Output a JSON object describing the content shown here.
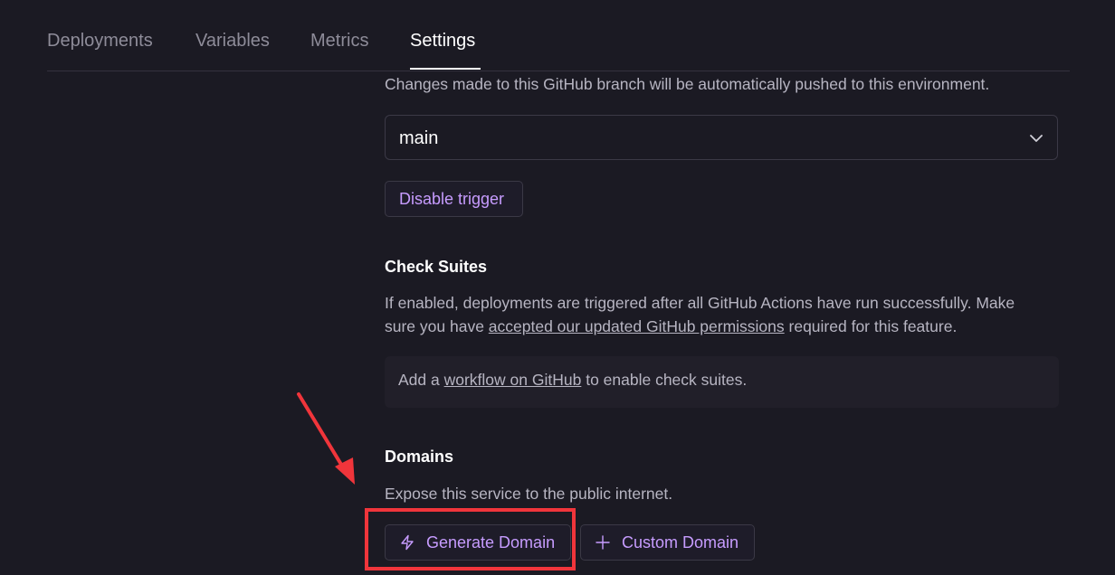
{
  "tabs": [
    {
      "label": "Deployments"
    },
    {
      "label": "Variables"
    },
    {
      "label": "Metrics"
    },
    {
      "label": "Settings",
      "active": true
    }
  ],
  "trigger": {
    "description": "Changes made to this GitHub branch will be automatically pushed to this environment.",
    "branch_value": "main",
    "disable_label": "Disable trigger"
  },
  "check_suites": {
    "title": "Check Suites",
    "desc_part1": "If enabled, deployments are triggered after all GitHub Actions have run successfully. Make",
    "desc_part2_prefix": "sure you have ",
    "desc_link": "accepted our updated GitHub permissions",
    "desc_part2_suffix": " required for this feature.",
    "info_prefix": "Add a ",
    "info_link": "workflow on GitHub",
    "info_suffix": " to enable check suites."
  },
  "domains": {
    "title": "Domains",
    "description": "Expose this service to the public internet.",
    "generate_label": "Generate Domain",
    "custom_label": "Custom Domain"
  },
  "colors": {
    "background": "#1b1a23",
    "accent": "#c79cff",
    "annotation": "#f0353b"
  },
  "icons": {
    "generate": "lightning-icon",
    "custom": "plus-icon",
    "select": "chevron-down-icon"
  }
}
